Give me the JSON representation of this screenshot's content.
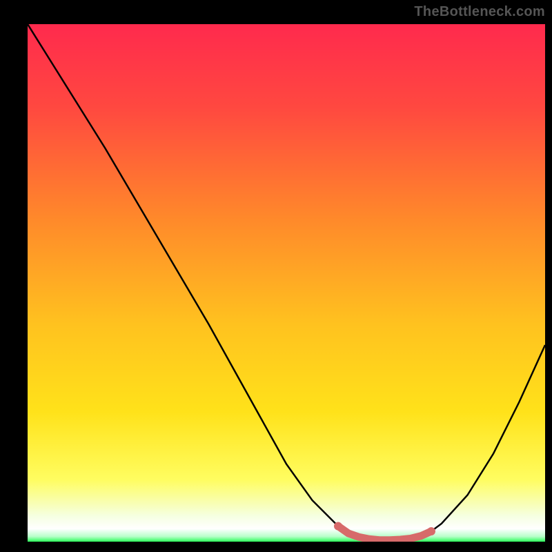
{
  "watermark": "TheBottleneck.com",
  "chart_data": {
    "type": "line",
    "title": "",
    "xlabel": "",
    "ylabel": "",
    "xlim": [
      0,
      100
    ],
    "ylim": [
      0,
      100
    ],
    "grid": false,
    "legend": false,
    "series": [
      {
        "name": "curve",
        "color": "#000000",
        "x": [
          0,
          5,
          10,
          15,
          20,
          25,
          30,
          35,
          40,
          45,
          50,
          55,
          60,
          62,
          64,
          66,
          68,
          70,
          72,
          74,
          76,
          78,
          80,
          85,
          90,
          95,
          100
        ],
        "values": [
          100,
          92,
          84,
          76,
          67.5,
          59,
          50.5,
          42,
          33,
          24,
          15,
          8,
          3,
          1.6,
          0.9,
          0.5,
          0.3,
          0.3,
          0.4,
          0.6,
          1.1,
          2.0,
          3.5,
          9,
          17,
          27,
          38
        ]
      }
    ],
    "highlight_segment": {
      "name": "optimal-zone",
      "color": "#d76a6a",
      "x": [
        60,
        62,
        64,
        66,
        68,
        70,
        72,
        74,
        76,
        78
      ],
      "values": [
        3.0,
        1.6,
        0.9,
        0.5,
        0.3,
        0.3,
        0.4,
        0.6,
        1.1,
        2.0
      ]
    },
    "gradient_background": {
      "top_color": "#ff2a4d",
      "mid_color": "#ffd21f",
      "bottom_edge_color": "#2cff5a",
      "bottom_band": "#ffffff"
    }
  }
}
